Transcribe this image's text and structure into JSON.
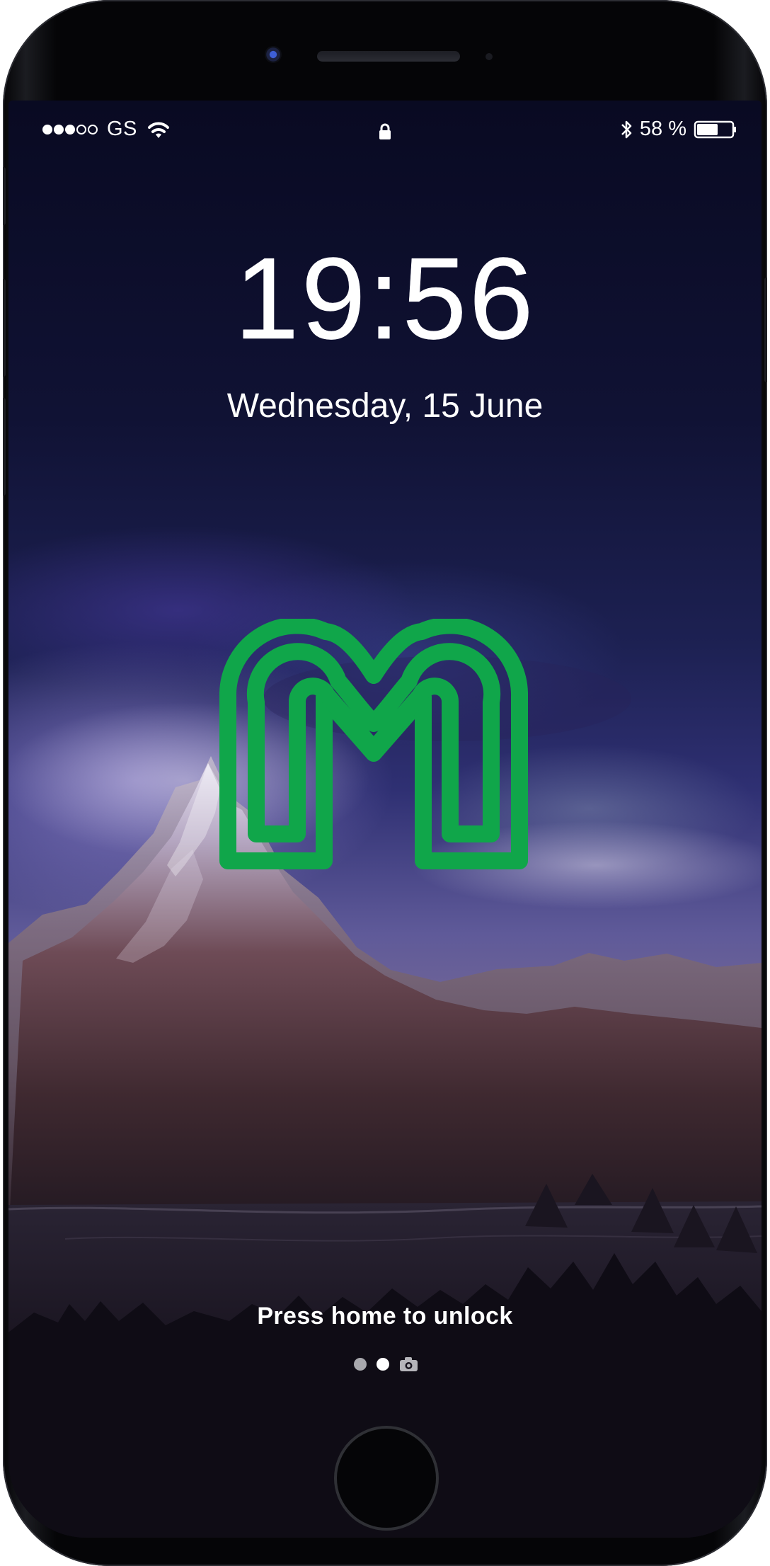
{
  "status_bar": {
    "signal": "●●●○○",
    "carrier": "GS",
    "battery": "58 %",
    "battery_level": 0.58,
    "icons": [
      "wifi-icon",
      "lock-icon",
      "bluetooth-icon",
      "battery-icon"
    ]
  },
  "lock_screen": {
    "time": "19:56",
    "date": "Wednesday, 15 June",
    "unlock_hint": "Press home to unlock",
    "logo_color": "#10a64a",
    "accent_color": "#ffffff"
  },
  "page_indicator": {
    "pages": 2,
    "active_page": 1,
    "icons": [
      "camera-icon"
    ]
  }
}
